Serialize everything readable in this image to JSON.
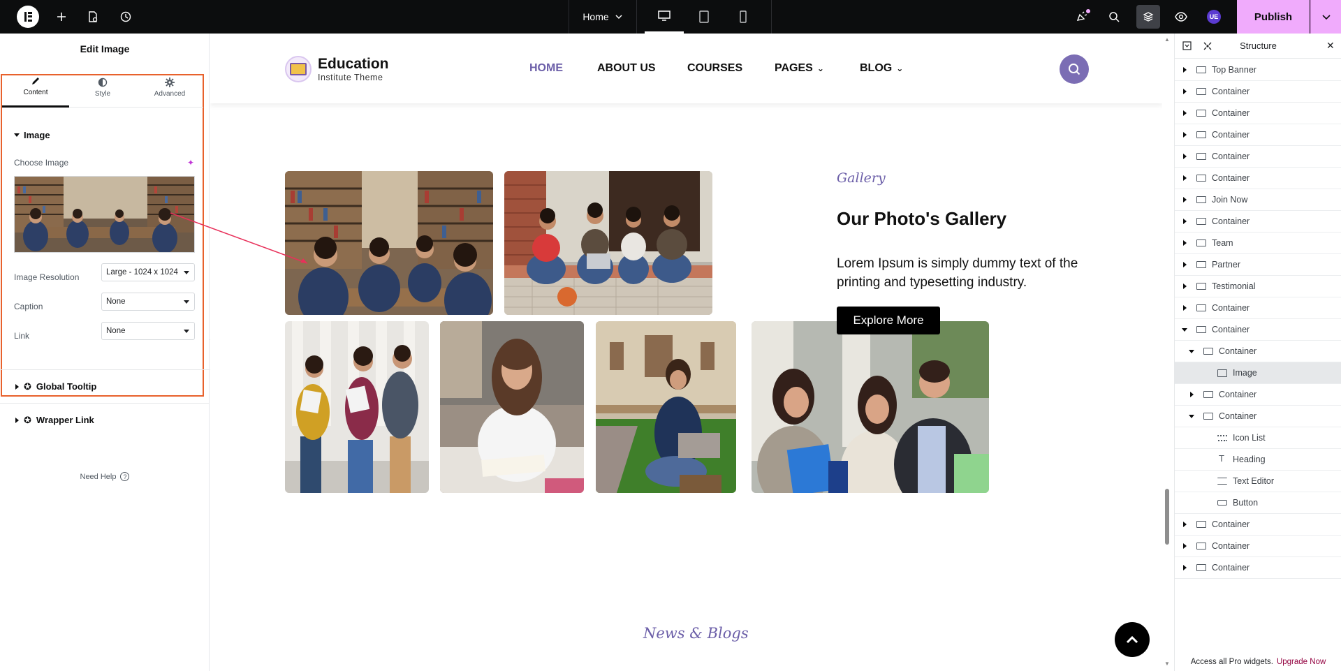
{
  "topbar": {
    "page_name": "Home",
    "publish_label": "Publish",
    "avatar_initials": "UE",
    "accent_color": "#f0abfc"
  },
  "left_panel": {
    "title": "Edit Image",
    "tabs": [
      {
        "label": "Content",
        "icon": "pencil-icon",
        "active": true
      },
      {
        "label": "Style",
        "icon": "contrast-icon",
        "active": false
      },
      {
        "label": "Advanced",
        "icon": "gear-icon",
        "active": false
      }
    ],
    "section_title": "Image",
    "choose_image_label": "Choose Image",
    "resolution_label": "Image Resolution",
    "resolution_value": "Large - 1024 x 1024",
    "caption_label": "Caption",
    "caption_value": "None",
    "link_label": "Link",
    "link_value": "None",
    "global_tooltip": "Global Tooltip",
    "wrapper_link": "Wrapper Link",
    "need_help": "Need Help"
  },
  "site": {
    "brand_name": "Education",
    "brand_tagline": "Institute Theme",
    "nav": [
      {
        "label": "HOME",
        "active": true,
        "dropdown": false
      },
      {
        "label": "ABOUT US",
        "active": false,
        "dropdown": false
      },
      {
        "label": "COURSES",
        "active": false,
        "dropdown": false
      },
      {
        "label": "PAGES",
        "active": false,
        "dropdown": true
      },
      {
        "label": "BLOG",
        "active": false,
        "dropdown": true
      }
    ],
    "gallery_tag": "Gallery",
    "gallery_heading": "Our Photo's Gallery",
    "gallery_text": "Lorem Ipsum is simply dummy text of the printing and typesetting industry.",
    "explore_button": "Explore More",
    "news_tag": "News & Blogs",
    "brand_color": "#6b5ea8"
  },
  "structure": {
    "title": "Structure",
    "items": [
      {
        "label": "Top Banner",
        "depth": 0,
        "toggle": "closed",
        "icon": "container-icon"
      },
      {
        "label": "Container",
        "depth": 0,
        "toggle": "closed",
        "icon": "container-icon"
      },
      {
        "label": "Container",
        "depth": 0,
        "toggle": "closed",
        "icon": "container-icon"
      },
      {
        "label": "Container",
        "depth": 0,
        "toggle": "closed",
        "icon": "container-icon"
      },
      {
        "label": "Container",
        "depth": 0,
        "toggle": "closed",
        "icon": "container-icon"
      },
      {
        "label": "Container",
        "depth": 0,
        "toggle": "closed",
        "icon": "container-icon"
      },
      {
        "label": "Join Now",
        "depth": 0,
        "toggle": "closed",
        "icon": "container-icon"
      },
      {
        "label": "Container",
        "depth": 0,
        "toggle": "closed",
        "icon": "container-icon"
      },
      {
        "label": "Team",
        "depth": 0,
        "toggle": "closed",
        "icon": "container-icon"
      },
      {
        "label": "Partner",
        "depth": 0,
        "toggle": "closed",
        "icon": "container-icon"
      },
      {
        "label": "Testimonial",
        "depth": 0,
        "toggle": "closed",
        "icon": "container-icon"
      },
      {
        "label": "Container",
        "depth": 0,
        "toggle": "closed",
        "icon": "container-icon"
      },
      {
        "label": "Container",
        "depth": 0,
        "toggle": "open",
        "icon": "container-icon"
      },
      {
        "label": "Container",
        "depth": 1,
        "toggle": "open",
        "icon": "container-icon"
      },
      {
        "label": "Image",
        "depth": 2,
        "toggle": "none",
        "icon": "image-icon",
        "selected": true
      },
      {
        "label": "Container",
        "depth": 1,
        "toggle": "closed",
        "icon": "container-icon"
      },
      {
        "label": "Container",
        "depth": 1,
        "toggle": "open",
        "icon": "container-icon"
      },
      {
        "label": "Icon List",
        "depth": 2,
        "toggle": "none",
        "icon": "icon-list-icon"
      },
      {
        "label": "Heading",
        "depth": 2,
        "toggle": "none",
        "icon": "heading-icon"
      },
      {
        "label": "Text Editor",
        "depth": 2,
        "toggle": "none",
        "icon": "text-editor-icon"
      },
      {
        "label": "Button",
        "depth": 2,
        "toggle": "none",
        "icon": "button-icon"
      },
      {
        "label": "Container",
        "depth": 0,
        "toggle": "closed",
        "icon": "container-icon"
      },
      {
        "label": "Container",
        "depth": 0,
        "toggle": "closed",
        "icon": "container-icon"
      },
      {
        "label": "Container",
        "depth": 0,
        "toggle": "closed",
        "icon": "container-icon"
      }
    ],
    "footer_text": "Access all Pro widgets.",
    "footer_link": "Upgrade Now"
  }
}
